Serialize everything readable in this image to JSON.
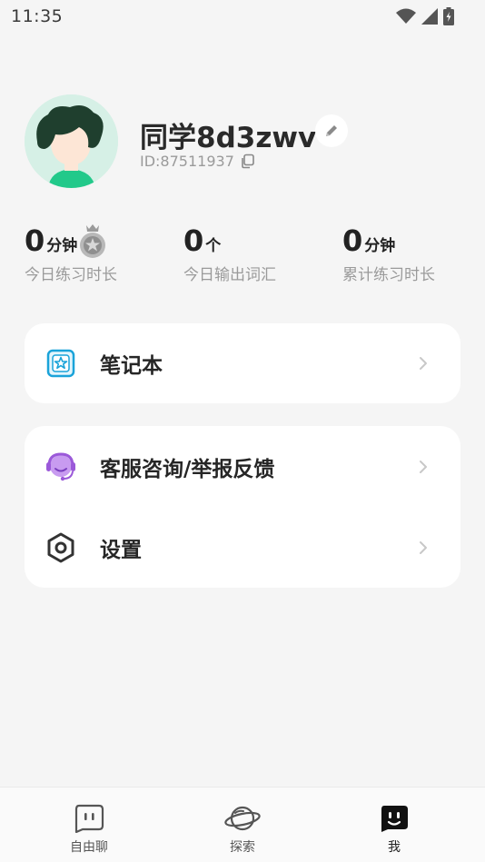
{
  "status_bar": {
    "time": "11:35",
    "icons": [
      "wifi-icon",
      "signal-icon",
      "battery-icon"
    ]
  },
  "profile": {
    "nickname": "同学8d3zwv",
    "user_id": "ID:87511937",
    "avatar_icon": "avatar-icon",
    "edit_icon": "pencil-icon",
    "copy_icon": "copy-icon"
  },
  "stats": [
    {
      "value": "0",
      "unit": "分钟",
      "label": "今日练习时长",
      "badge_icon": "medal-icon"
    },
    {
      "value": "0",
      "unit": "个",
      "label": "今日输出词汇"
    },
    {
      "value": "0",
      "unit": "分钟",
      "label": "累计练习时长"
    }
  ],
  "menu_card_1": {
    "items": [
      {
        "label": "笔记本",
        "icon": "notebook-icon"
      }
    ]
  },
  "menu_card_2": {
    "items": [
      {
        "label": "客服咨询/举报反馈",
        "icon": "customer-service-icon"
      },
      {
        "label": "设置",
        "icon": "settings-icon"
      }
    ]
  },
  "tabbar": {
    "tabs": [
      {
        "label": "自由聊",
        "icon": "chat-face-icon",
        "active": false
      },
      {
        "label": "探索",
        "icon": "planet-icon",
        "active": false
      },
      {
        "label": "我",
        "icon": "me-face-icon",
        "active": true
      }
    ]
  },
  "colors": {
    "background": "#f5f5f5",
    "card": "#ffffff",
    "avatar_bg": "#d6f0e6",
    "avatar_hair": "#1f3f2e",
    "avatar_shirt": "#22c98a",
    "notebook_accent": "#1aa3d9",
    "service_accent": "#9b59d9",
    "secondary_text": "#9a9a9a"
  }
}
